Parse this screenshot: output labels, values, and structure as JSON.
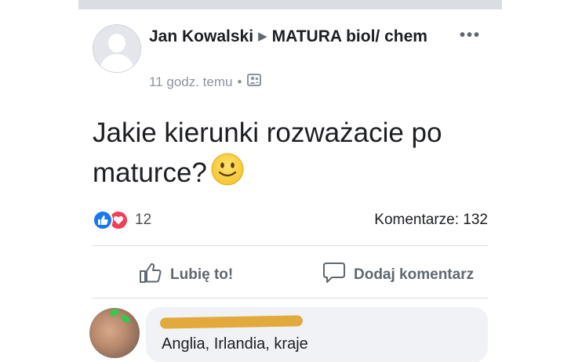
{
  "post": {
    "author": "Jan Kowalski",
    "group": "MATURA biol/ chem",
    "time": "11 godz. temu",
    "privacy_icon": "group-members-icon",
    "text": "Jakie kierunki rozważacie po maturce?",
    "emoji": "slightly-smiling-face"
  },
  "stats": {
    "reaction_count": "12",
    "comments": "Komentarze: 132"
  },
  "actions": {
    "like": "Lubię to!",
    "comment": "Dodaj komentarz"
  },
  "comment": {
    "text_partial": "Anglia, Irlandia, kraje"
  },
  "colors": {
    "like_blue": "#1877f2",
    "love_red": "#f33e58",
    "redaction": "#e2a93c"
  }
}
